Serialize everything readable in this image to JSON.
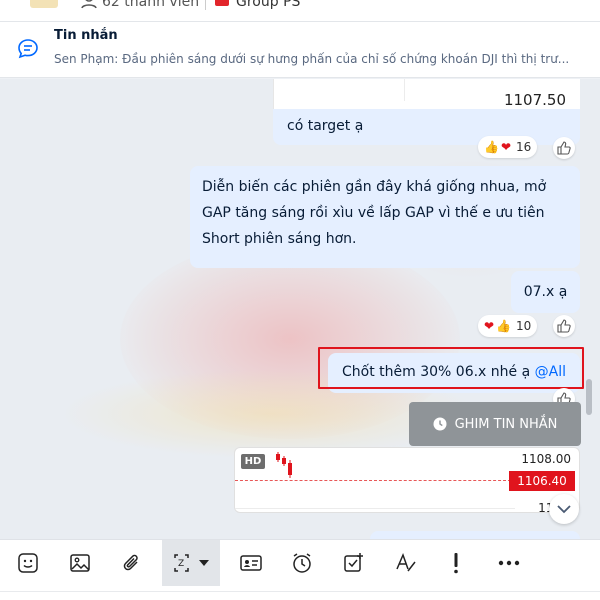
{
  "header": {
    "members": "62 thành viên",
    "group_tag": "Group PS"
  },
  "pinned": {
    "title": "Tin nhắn",
    "preview": "Sen Phạm: Đầu phiên sáng dưới sự hưng phấn của chỉ số chứng khoán DJI thì thị trư..."
  },
  "messages": {
    "chart_price_top": "1107.50",
    "target_text": "có target ạ",
    "target_reaction_count": "16",
    "analysis_text": "Diễn biến các phiên gần đây khá giống nhua, mở GAP tăng sáng rồi xìu về lấp GAP vì thế e ưu tiên Short phiên sáng hơn.",
    "short_text": "07.x ạ",
    "short_reaction_count": "10",
    "close_text": "Chốt thêm 30% 06.x nhé ạ ",
    "mention": "@All",
    "pin_button": "GHIM TIN NHẮN",
    "chart_hd": "HD",
    "chart_price_1": "1108.00",
    "chart_price_2": "1106.40",
    "chart_price_3": "110"
  },
  "colors": {
    "bubble": "#e5efff",
    "mention": "#0068ff",
    "highlight": "#e0141d",
    "price_marker": "#e0141d"
  },
  "toolbar": {
    "icons": [
      "sticker-icon",
      "image-icon",
      "attach-icon",
      "screenshot-icon",
      "contact-card-icon",
      "reminder-icon",
      "task-icon",
      "format-text-icon",
      "urgent-icon",
      "more-icon"
    ]
  }
}
